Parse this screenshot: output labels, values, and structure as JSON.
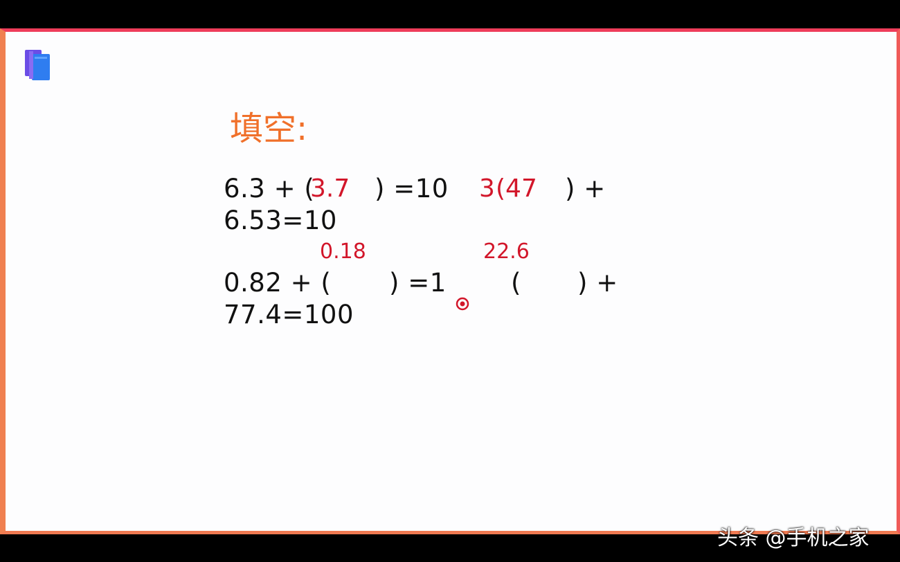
{
  "slide": {
    "title": "填空:",
    "icon": "book-icon",
    "problems": [
      {
        "part1": "6.3 + (",
        "answer": "3.7",
        "part2": ") =10",
        "continuation": ""
      },
      {
        "prefix": "3",
        "answer": "(47",
        "part2": ") +",
        "continuation": "6.53=10"
      },
      {
        "part1": "0.82 + (",
        "answer": "0.18",
        "part2": ") =1",
        "continuation": ""
      },
      {
        "part1": "(",
        "answer": "22.6",
        "part2": ") +",
        "continuation": "77.4=100"
      }
    ]
  },
  "watermark": "头条 @手机之家",
  "colors": {
    "title": "#f0702a",
    "answer": "#d2162a",
    "border_top": "#ee3c5a",
    "border_left": "#f08050"
  }
}
